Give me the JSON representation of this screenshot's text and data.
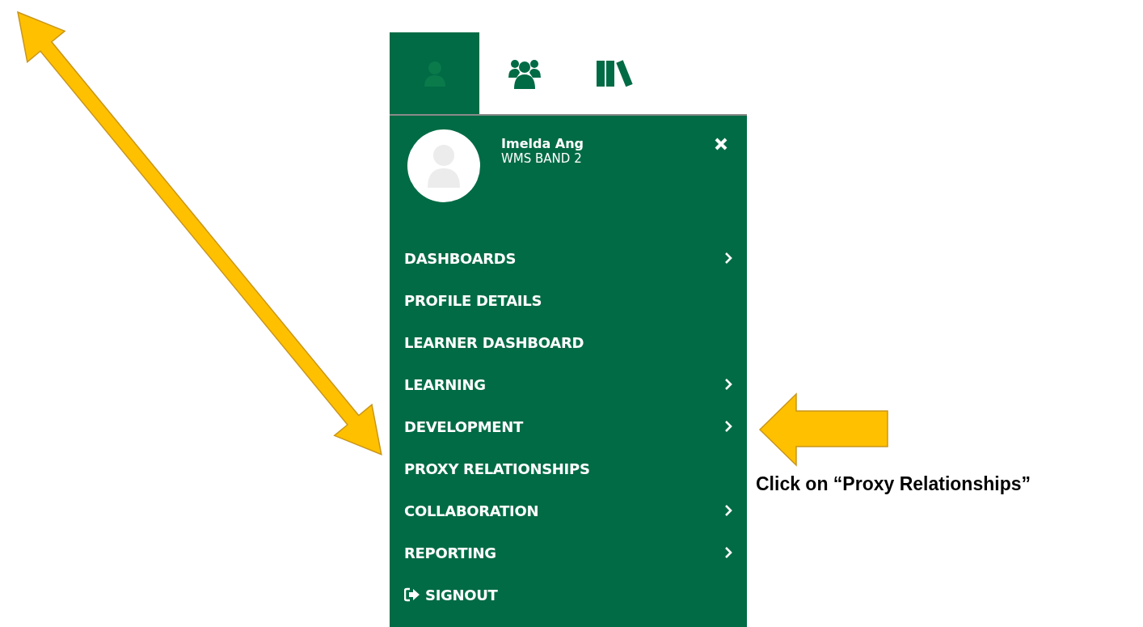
{
  "tabs": [
    {
      "selected": true
    },
    {
      "selected": false
    },
    {
      "selected": false
    }
  ],
  "profile": {
    "name": "Imelda Ang",
    "subtitle": "WMS BAND 2"
  },
  "menu": [
    {
      "label": "DASHBOARDS",
      "kind": "link",
      "submenu": true
    },
    {
      "label": "PROFILE DETAILS",
      "kind": "link",
      "submenu": false
    },
    {
      "label": "LEARNER DASHBOARD",
      "kind": "link",
      "submenu": false
    },
    {
      "label": "LEARNING",
      "kind": "link",
      "submenu": true
    },
    {
      "label": "DEVELOPMENT",
      "kind": "link",
      "submenu": true
    },
    {
      "label": "PROXY RELATIONSHIPS",
      "kind": "link",
      "submenu": false
    },
    {
      "label": "COLLABORATION",
      "kind": "link",
      "submenu": true
    },
    {
      "label": "REPORTING",
      "kind": "link",
      "submenu": true
    },
    {
      "label": "SIGNOUT",
      "kind": "signout",
      "submenu": false
    }
  ],
  "annotation": {
    "text": "Click on “Proxy Relationships”"
  }
}
